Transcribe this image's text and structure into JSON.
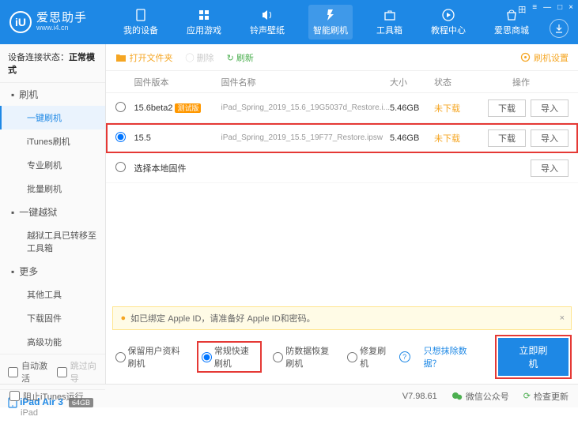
{
  "app": {
    "name": "爱思助手",
    "url": "www.i4.cn",
    "logo_letter": "iU"
  },
  "win_controls": [
    "田",
    "≡",
    "—",
    "□",
    "×"
  ],
  "nav": [
    {
      "label": "我的设备",
      "icon": "device"
    },
    {
      "label": "应用游戏",
      "icon": "apps"
    },
    {
      "label": "铃声壁纸",
      "icon": "ringtone"
    },
    {
      "label": "智能刷机",
      "icon": "flash",
      "active": true
    },
    {
      "label": "工具箱",
      "icon": "toolbox"
    },
    {
      "label": "教程中心",
      "icon": "tutorial"
    },
    {
      "label": "爱思商城",
      "icon": "store"
    }
  ],
  "sidebar": {
    "status_label": "设备连接状态：",
    "status_value": "正常模式",
    "sections": [
      {
        "head": "刷机",
        "icon": "flash-blue",
        "items": [
          {
            "label": "一键刷机",
            "active": true
          },
          {
            "label": "iTunes刷机"
          },
          {
            "label": "专业刷机"
          },
          {
            "label": "批量刷机"
          }
        ]
      },
      {
        "head": "一键越狱",
        "icon": "lock",
        "items": [
          {
            "label": "越狱工具已转移至工具箱"
          }
        ]
      },
      {
        "head": "更多",
        "icon": "more",
        "items": [
          {
            "label": "其他工具"
          },
          {
            "label": "下载固件"
          },
          {
            "label": "高级功能"
          }
        ]
      }
    ],
    "auto_activate": "自动激活",
    "skip_guide": "跳过向导",
    "device_name": "iPad Air 3",
    "device_storage": "64GB",
    "device_type": "iPad"
  },
  "toolbar": {
    "open_folder": "打开文件夹",
    "delete": "删除",
    "refresh": "刷新",
    "settings": "刷机设置"
  },
  "table": {
    "headers": {
      "version": "固件版本",
      "name": "固件名称",
      "size": "大小",
      "status": "状态",
      "ops": "操作"
    },
    "rows": [
      {
        "version": "15.6beta2",
        "beta_tag": "测试版",
        "name": "iPad_Spring_2019_15.6_19G5037d_Restore.i...",
        "size": "5.46GB",
        "status": "未下载",
        "selected": false,
        "highlighted": false
      },
      {
        "version": "15.5",
        "name": "iPad_Spring_2019_15.5_19F77_Restore.ipsw",
        "size": "5.46GB",
        "status": "未下载",
        "selected": true,
        "highlighted": true
      }
    ],
    "local_fw": "选择本地固件",
    "btn_download": "下载",
    "btn_import": "导入"
  },
  "warn": "如已绑定 Apple ID，请准备好 Apple ID和密码。",
  "options": {
    "opt1": "保留用户资料刷机",
    "opt2": "常规快速刷机",
    "opt3": "防数据恢复刷机",
    "opt4": "修复刷机",
    "link": "只想抹除数据？",
    "flash_btn": "立即刷机"
  },
  "footer": {
    "block_itunes": "阻止iTunes运行",
    "version": "V7.98.61",
    "wechat": "微信公众号",
    "check_update": "检查更新"
  }
}
